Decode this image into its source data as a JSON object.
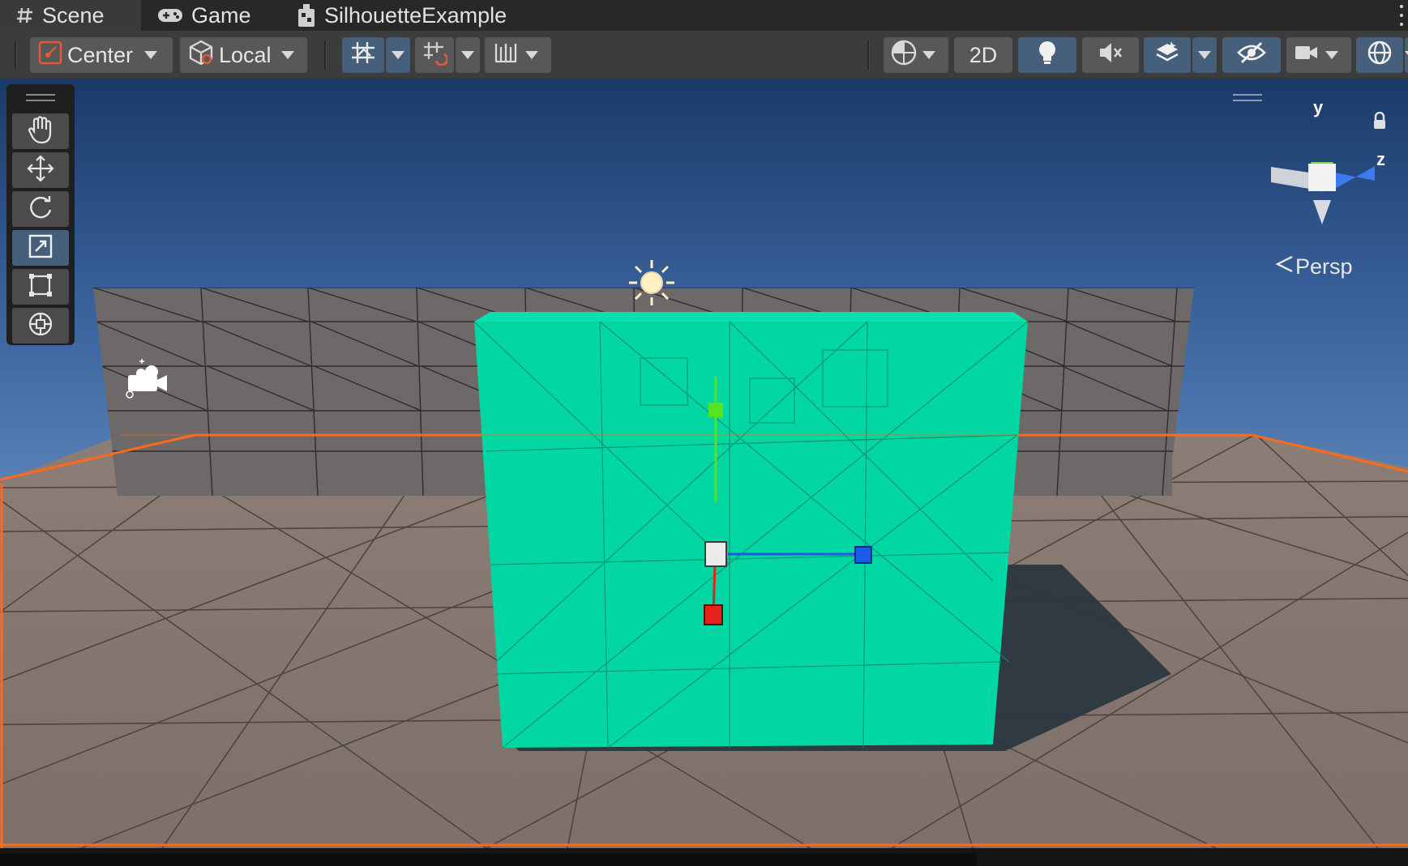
{
  "tabs": [
    {
      "label": "Scene",
      "icon": "hash-icon",
      "active": true
    },
    {
      "label": "Game",
      "icon": "gamepad-icon",
      "active": false
    },
    {
      "label": "SilhouetteExample",
      "icon": "unity-package-icon",
      "active": false
    }
  ],
  "toolbar": {
    "pivot_label": "Center",
    "space_label": "Local",
    "mode_2d_label": "2D"
  },
  "tools": [
    "hand-tool",
    "move-tool",
    "rotate-tool",
    "scale-tool",
    "rect-tool",
    "transform-tool"
  ],
  "active_tool": "scale-tool",
  "gizmo": {
    "y_label": "y",
    "z_label": "z",
    "projection_label": "Persp"
  },
  "colors": {
    "cube": "#02d7a3",
    "sky_top": "#1a3a6a",
    "sky_horizon": "#4d78ae",
    "ground": "#8a7b72",
    "wall": "#6e6969",
    "selection_outline": "#ff6a1a",
    "axis_x": "#e5221b",
    "axis_y": "#55e51e",
    "axis_z": "#1d5ae8",
    "toolbar_active": "#46607c"
  }
}
